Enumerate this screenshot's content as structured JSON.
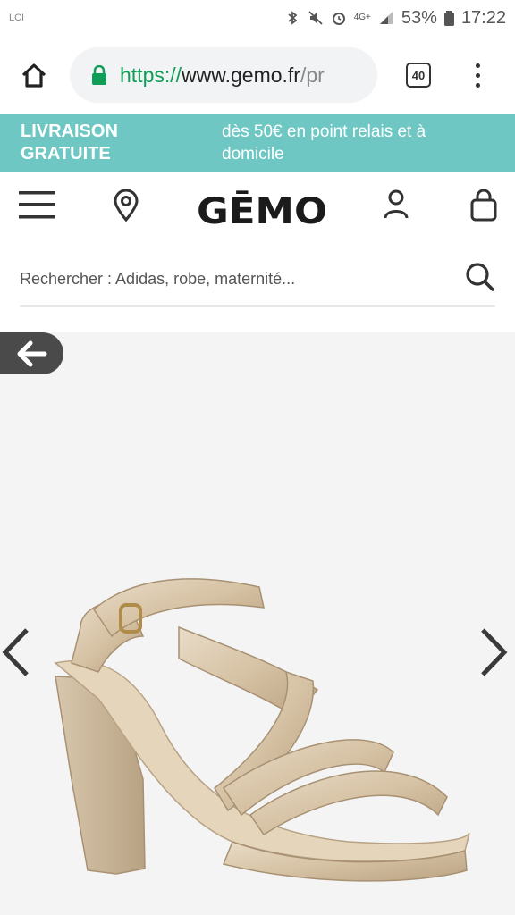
{
  "status_bar": {
    "carrier_logo": "LCI",
    "network": "4G+",
    "battery": "53%",
    "time": "17:22"
  },
  "browser": {
    "url_scheme": "https://",
    "url_host": "www.gemo.fr",
    "url_path": "/pr",
    "tab_count": "40"
  },
  "promo": {
    "title": "LIVRAISON GRATUITE",
    "text": "dès 50€ en point relais et à domicile"
  },
  "header": {
    "logo": "GĒMO"
  },
  "search": {
    "placeholder": "Rechercher : Adidas, robe, maternité..."
  },
  "colors": {
    "promo_bg": "#6fc7c4",
    "url_green": "#0f9d58",
    "back_button_bg": "#4a4a4a",
    "product_bg": "#f4f4f4"
  },
  "icons": {
    "home": "home-icon",
    "lock": "lock-icon",
    "menu": "hamburger-menu-icon",
    "store": "location-pin-icon",
    "account": "user-icon",
    "bag": "shopping-bag-icon",
    "search": "search-icon",
    "back": "arrow-left-icon",
    "prev": "chevron-left-icon",
    "next": "chevron-right-icon"
  }
}
